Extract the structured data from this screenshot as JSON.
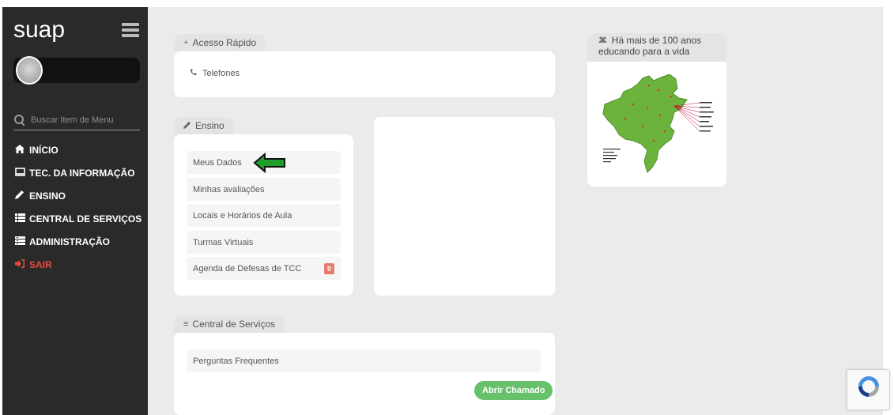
{
  "sidebar": {
    "logo": "suap",
    "search_placeholder": "Buscar Item de Menu",
    "items": [
      {
        "label": "INÍCIO",
        "icon": "home-icon"
      },
      {
        "label": "TEC. DA INFORMAÇÃO",
        "icon": "monitor-icon"
      },
      {
        "label": "ENSINO",
        "icon": "pencil-icon"
      },
      {
        "label": "CENTRAL DE SERVIÇOS",
        "icon": "list-icon"
      },
      {
        "label": "ADMINISTRAÇÃO",
        "icon": "building-icon"
      },
      {
        "label": "SAIR",
        "icon": "exit-icon"
      }
    ]
  },
  "acesso_rapido": {
    "title": "Acesso Rápido",
    "telefones": "Telefones"
  },
  "ensino": {
    "title": "Ensino",
    "items": [
      {
        "label": "Meus Dados"
      },
      {
        "label": "Minhas avaliações"
      },
      {
        "label": "Locais e Horários de Aula"
      },
      {
        "label": "Turmas Virtuais"
      },
      {
        "label": "Agenda de Defesas de TCC",
        "badge": "0"
      }
    ]
  },
  "central_servicos": {
    "title": "Central de Serviços",
    "faq": "Perguntas Frequentes",
    "button": "Abrir Chamado"
  },
  "info_card": {
    "title_line1": "Há mais de 100 anos",
    "title_line2": "educando para a vida"
  },
  "colors": {
    "sidebar_bg": "#2a2a2a",
    "main_bg": "#ebebeb",
    "green_button": "#67c16a",
    "exit_red": "#e74c3c",
    "arrow_green": "#1e9e2a",
    "map_green": "#6cb33e"
  }
}
